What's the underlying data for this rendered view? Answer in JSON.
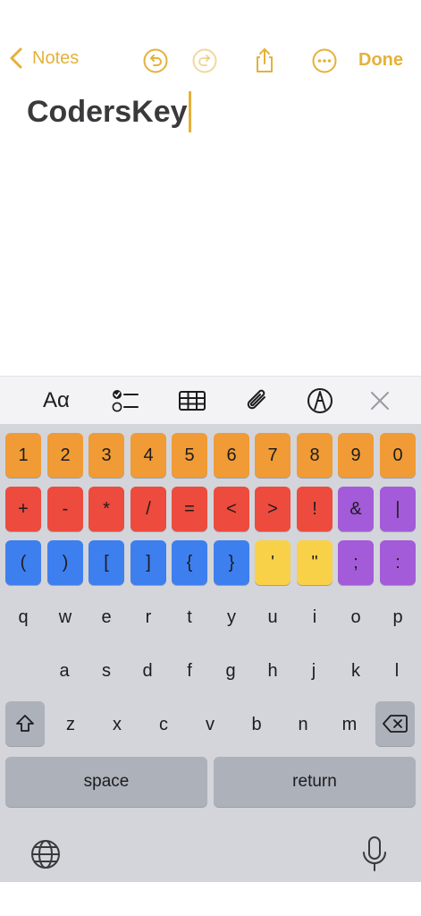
{
  "nav": {
    "back_label": "Notes",
    "done_label": "Done",
    "accent": "#E5B13A",
    "icons": [
      "chevron-left-icon",
      "undo-icon",
      "redo-icon",
      "share-icon",
      "more-icon"
    ]
  },
  "note": {
    "text": "CodersKey"
  },
  "toolbar": {
    "aa_label": "Aα",
    "icons": [
      "checklist-icon",
      "table-icon",
      "paperclip-icon",
      "markup-pen-icon",
      "close-icon"
    ]
  },
  "keyboard": {
    "digits": [
      "1",
      "2",
      "3",
      "4",
      "5",
      "6",
      "7",
      "8",
      "9",
      "0"
    ],
    "symbols": [
      "+",
      "-",
      "*",
      "/",
      "=",
      "<",
      ">",
      "!",
      "&",
      "|"
    ],
    "brackets": [
      "(",
      ")",
      "[",
      "]",
      "{",
      "}",
      "'",
      "\"",
      ";",
      ":"
    ],
    "row_q": [
      "q",
      "w",
      "e",
      "r",
      "t",
      "y",
      "u",
      "i",
      "o",
      "p"
    ],
    "row_a": [
      "a",
      "s",
      "d",
      "f",
      "g",
      "h",
      "j",
      "k",
      "l"
    ],
    "row_z": [
      "z",
      "x",
      "c",
      "v",
      "b",
      "n",
      "m"
    ],
    "space_label": "space",
    "return_label": "return",
    "colors": {
      "orange": "#F09B35",
      "red": "#EC4B3D",
      "purple": "#A35BD9",
      "blue": "#3D7FEE",
      "yellow": "#F9D149"
    }
  }
}
